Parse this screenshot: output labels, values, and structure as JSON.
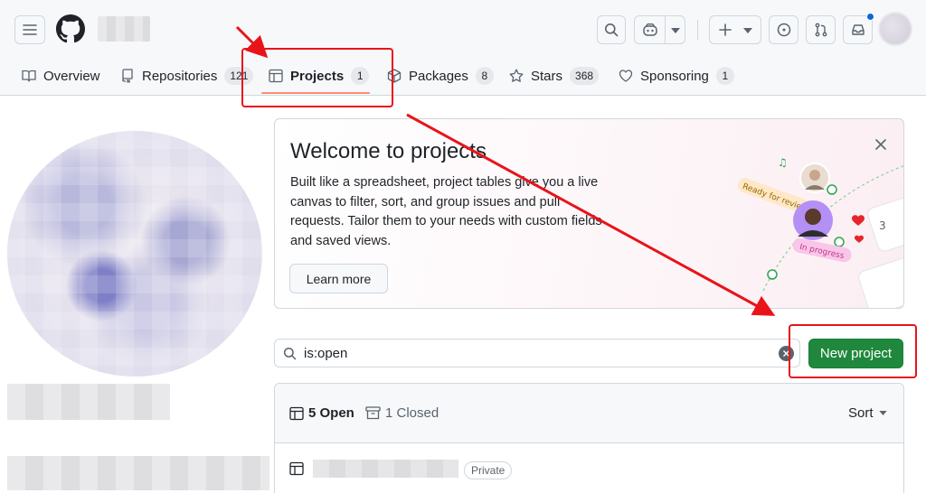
{
  "header": {
    "menu_icon": "hamburger-icon",
    "logo_icon": "github-logo-icon",
    "search_icon": "search-icon",
    "copilot_icon": "copilot-icon",
    "create_icon": "plus-icon",
    "issues_icon": "issue-opened-icon",
    "pulls_icon": "git-pull-request-icon",
    "inbox_icon": "inbox-icon"
  },
  "tabs": [
    {
      "label": "Overview",
      "icon": "book-icon",
      "count": ""
    },
    {
      "label": "Repositories",
      "icon": "repo-icon",
      "count": "121"
    },
    {
      "label": "Projects",
      "icon": "table-icon",
      "count": "1"
    },
    {
      "label": "Packages",
      "icon": "package-icon",
      "count": "8"
    },
    {
      "label": "Stars",
      "icon": "star-icon",
      "count": "368"
    },
    {
      "label": "Sponsoring",
      "icon": "heart-icon",
      "count": "1"
    }
  ],
  "welcome": {
    "title": "Welcome to projects",
    "body": "Built like a spreadsheet, project tables give you a live canvas to filter, sort, and group issues and pull requests. Tailor them to your needs with custom fields and saved views.",
    "learn_more": "Learn more",
    "illustration": {
      "tag_ready": "Ready for review",
      "tag_progress": "In progress",
      "card_number": "3"
    }
  },
  "search": {
    "value": "is:open"
  },
  "new_project_label": "New project",
  "list": {
    "open_label": "5 Open",
    "closed_label": "1 Closed",
    "sort_label": "Sort",
    "rows": [
      {
        "visibility": "Private"
      }
    ]
  },
  "colors": {
    "accent_green": "#1f883d",
    "annotation_red": "#e8141a",
    "active_tab_underline": "#fd8c73"
  }
}
